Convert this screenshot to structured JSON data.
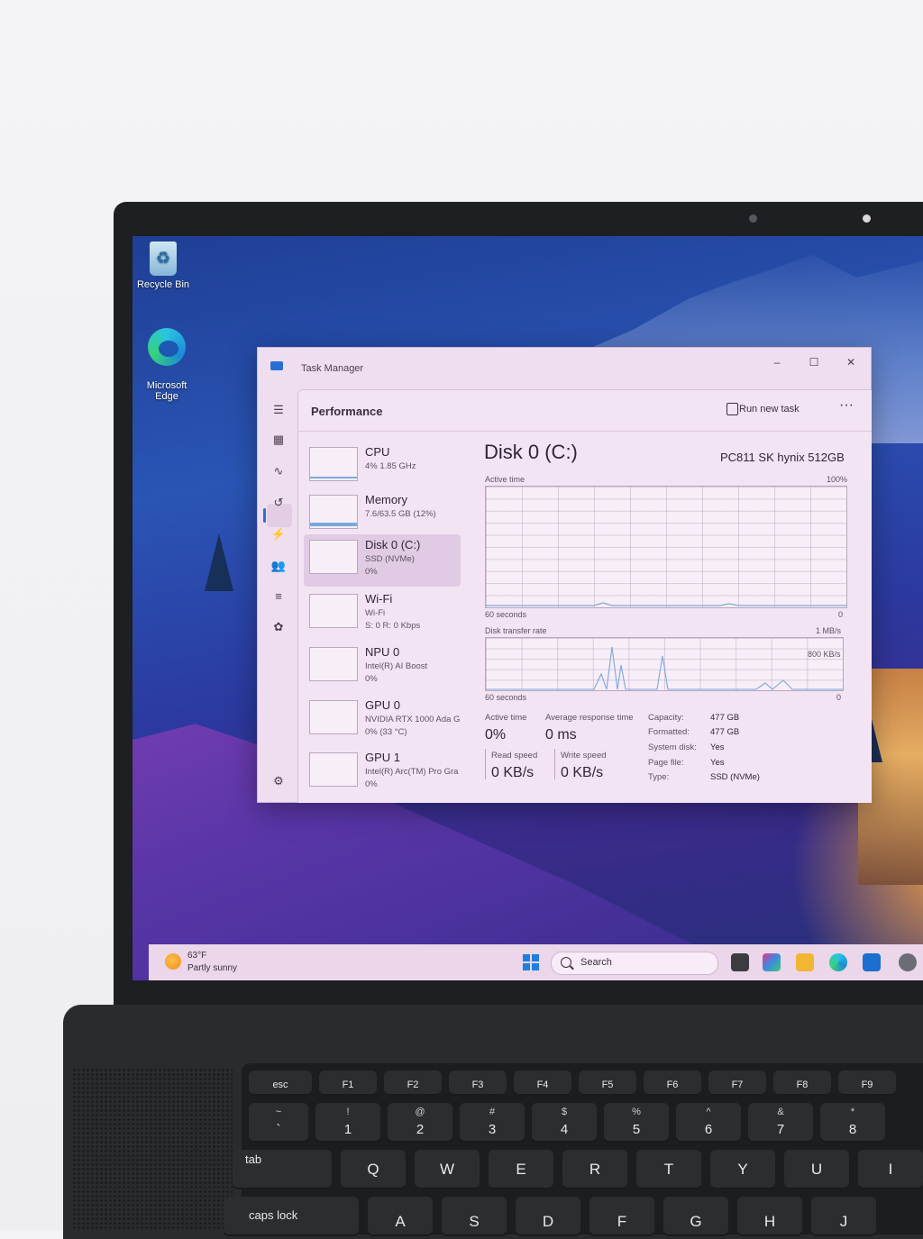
{
  "desktop": {
    "icons": [
      {
        "label": "Recycle Bin"
      },
      {
        "label": "Microsoft\nEdge"
      }
    ]
  },
  "task_manager": {
    "title": "Task Manager",
    "window_controls": {
      "minimize": "–",
      "maximize": "☐",
      "close": "✕"
    },
    "header": {
      "title": "Performance",
      "run_new_task": "Run new task",
      "more": "···"
    },
    "devices": [
      {
        "name": "CPU",
        "sub1": "4%  1.85 GHz",
        "sub2": ""
      },
      {
        "name": "Memory",
        "sub1": "7.6/63.5 GB (12%)",
        "sub2": ""
      },
      {
        "name": "Disk 0 (C:)",
        "sub1": "SSD (NVMe)",
        "sub2": "0%"
      },
      {
        "name": "Wi-Fi",
        "sub1": "Wi-Fi",
        "sub2": "S: 0  R: 0 Kbps"
      },
      {
        "name": "NPU 0",
        "sub1": "Intel(R) AI Boost",
        "sub2": "0%"
      },
      {
        "name": "GPU 0",
        "sub1": "NVIDIA RTX 1000 Ada G",
        "sub2": "0%  (33 °C)"
      },
      {
        "name": "GPU 1",
        "sub1": "Intel(R) Arc(TM) Pro Gra",
        "sub2": "0%"
      }
    ],
    "selected_device": 2,
    "detail": {
      "title": "Disk 0 (C:)",
      "model": "PC811 SK hynix 512GB",
      "graph1": {
        "label": "Active time",
        "max": "100%",
        "time": "60 seconds",
        "min": "0"
      },
      "graph2": {
        "label": "Disk transfer rate",
        "max": "1 MB/s",
        "mid": "800 KB/s",
        "time": "60 seconds",
        "min": "0"
      },
      "stats": {
        "active_time_label": "Active time",
        "active_time": "0%",
        "avg_resp_label": "Average response time",
        "avg_resp": "0 ms",
        "read_label": "Read speed",
        "read": "0 KB/s",
        "write_label": "Write speed",
        "write": "0 KB/s"
      },
      "properties": [
        {
          "k": "Capacity:",
          "v": "477 GB"
        },
        {
          "k": "Formatted:",
          "v": "477 GB"
        },
        {
          "k": "System disk:",
          "v": "Yes"
        },
        {
          "k": "Page file:",
          "v": "Yes"
        },
        {
          "k": "Type:",
          "v": "SSD (NVMe)"
        }
      ]
    }
  },
  "taskbar": {
    "weather_temp": "63°F",
    "weather_desc": "Partly sunny",
    "search_placeholder": "Search"
  },
  "keyboard": {
    "fn_row": [
      "esc",
      "F1",
      "F2",
      "F3",
      "F4",
      "F5",
      "F6",
      "F7",
      "F8",
      "F9"
    ],
    "number_row": [
      {
        "top": "~",
        "main": "`"
      },
      {
        "top": "!",
        "main": "1"
      },
      {
        "top": "@",
        "main": "2"
      },
      {
        "top": "#",
        "main": "3"
      },
      {
        "top": "$",
        "main": "4"
      },
      {
        "top": "%",
        "main": "5"
      },
      {
        "top": "^",
        "main": "6"
      },
      {
        "top": "&",
        "main": "7"
      },
      {
        "top": "*",
        "main": "8"
      }
    ],
    "qwerty_row": [
      "tab",
      "Q",
      "W",
      "E",
      "R",
      "T",
      "Y",
      "U",
      "I"
    ],
    "home_row": [
      "caps lock",
      "A",
      "S",
      "D",
      "F",
      "G",
      "H",
      "J"
    ]
  }
}
